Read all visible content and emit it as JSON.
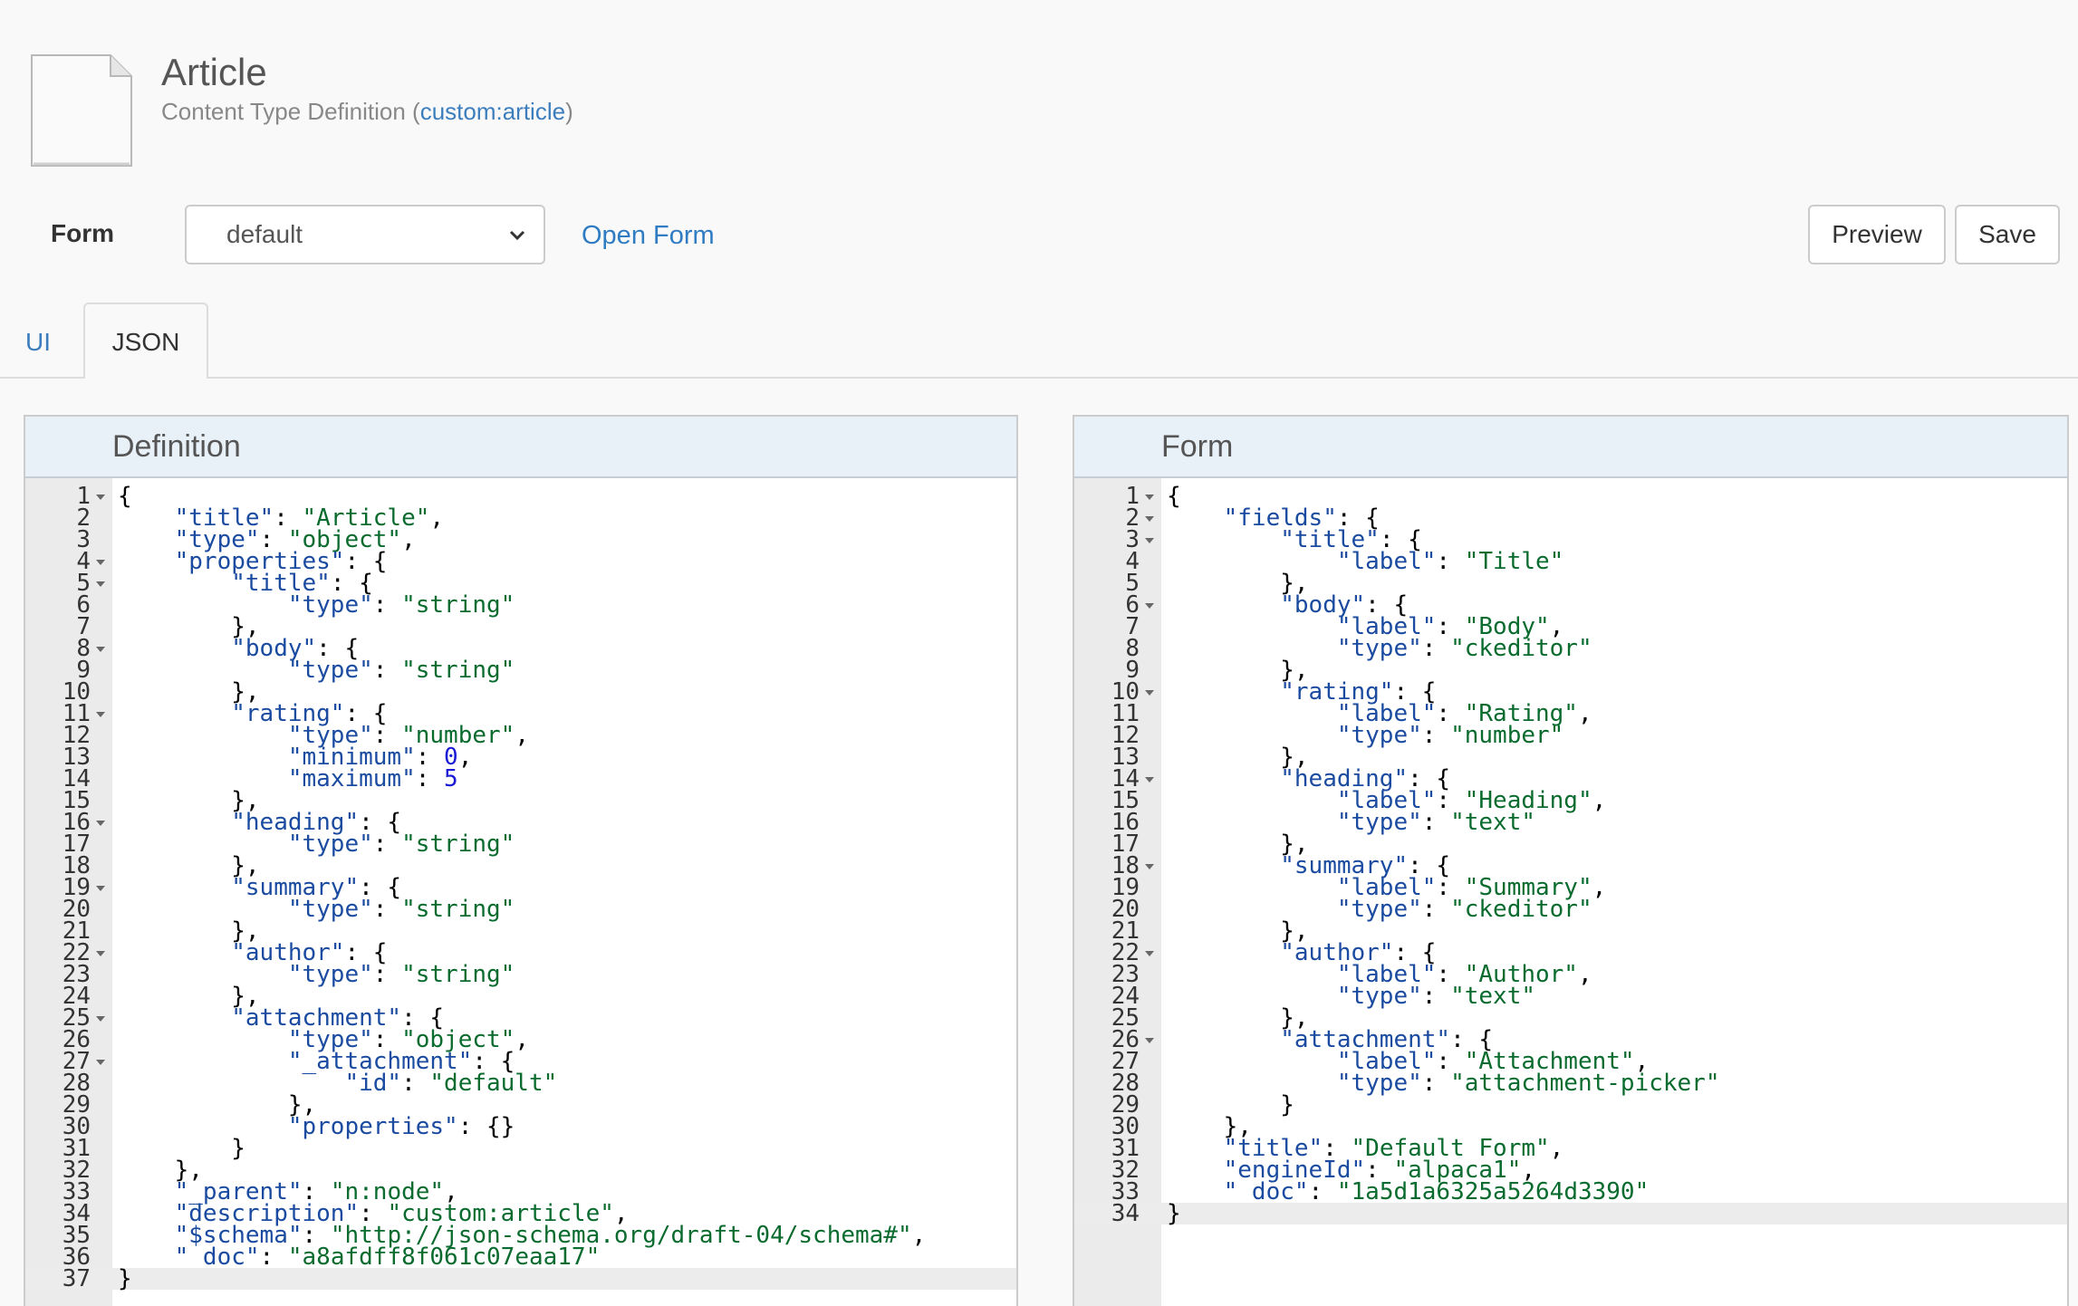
{
  "header": {
    "title": "Article",
    "subtitle_prefix": "Content Type Definition (",
    "subtitle_link": "custom:article",
    "subtitle_suffix": ")"
  },
  "toolbar": {
    "form_label": "Form",
    "form_select_value": "default",
    "open_form_label": "Open Form",
    "preview_label": "Preview",
    "save_label": "Save"
  },
  "tabs": [
    {
      "label": "UI",
      "active": false
    },
    {
      "label": "JSON",
      "active": true
    }
  ],
  "panels": {
    "definition": {
      "title": "Definition",
      "lines": [
        "{",
        "    \"title\": \"Article\",",
        "    \"type\": \"object\",",
        "    \"properties\": {",
        "        \"title\": {",
        "            \"type\": \"string\"",
        "        },",
        "        \"body\": {",
        "            \"type\": \"string\"",
        "        },",
        "        \"rating\": {",
        "            \"type\": \"number\",",
        "            \"minimum\": 0,",
        "            \"maximum\": 5",
        "        },",
        "        \"heading\": {",
        "            \"type\": \"string\"",
        "        },",
        "        \"summary\": {",
        "            \"type\": \"string\"",
        "        },",
        "        \"author\": {",
        "            \"type\": \"string\"",
        "        },",
        "        \"attachment\": {",
        "            \"type\": \"object\",",
        "            \"_attachment\": {",
        "                \"id\": \"default\"",
        "            },",
        "            \"properties\": {}",
        "        }",
        "    },",
        "    \"_parent\": \"n:node\",",
        "    \"description\": \"custom:article\",",
        "    \"$schema\": \"http://json-schema.org/draft-04/schema#\",",
        "    \"_doc\": \"a8afdff8f061c07eaa17\"",
        "}"
      ],
      "fold_lines": [
        1,
        4,
        5,
        8,
        11,
        16,
        19,
        22,
        25,
        27
      ],
      "active_line": 37
    },
    "form": {
      "title": "Form",
      "lines": [
        "{",
        "    \"fields\": {",
        "        \"title\": {",
        "            \"label\": \"Title\"",
        "        },",
        "        \"body\": {",
        "            \"label\": \"Body\",",
        "            \"type\": \"ckeditor\"",
        "        },",
        "        \"rating\": {",
        "            \"label\": \"Rating\",",
        "            \"type\": \"number\"",
        "        },",
        "        \"heading\": {",
        "            \"label\": \"Heading\",",
        "            \"type\": \"text\"",
        "        },",
        "        \"summary\": {",
        "            \"label\": \"Summary\",",
        "            \"type\": \"ckeditor\"",
        "        },",
        "        \"author\": {",
        "            \"label\": \"Author\",",
        "            \"type\": \"text\"",
        "        },",
        "        \"attachment\": {",
        "            \"label\": \"Attachment\",",
        "            \"type\": \"attachment-picker\"",
        "        }",
        "    },",
        "    \"title\": \"Default Form\",",
        "    \"engineId\": \"alpaca1\",",
        "    \"_doc\": \"1a5d1a6325a5264d3390\"",
        "}"
      ],
      "fold_lines": [
        1,
        2,
        3,
        6,
        10,
        14,
        18,
        22,
        26
      ],
      "active_line": 34
    }
  }
}
